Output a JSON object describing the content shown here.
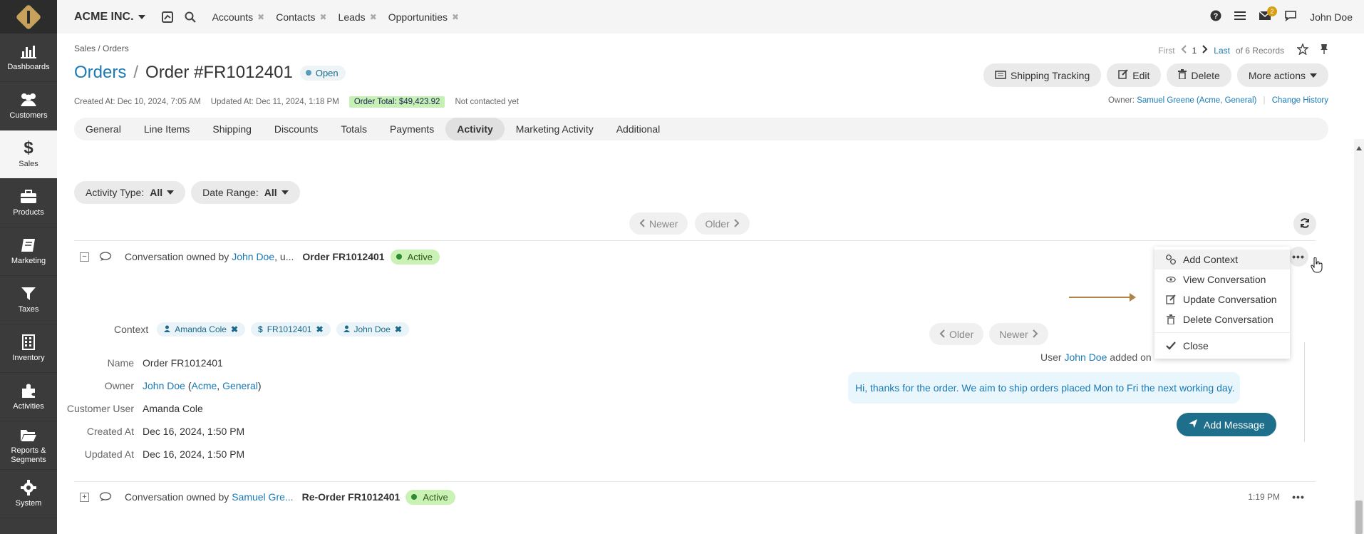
{
  "sidebar": {
    "items": [
      {
        "label": "Dashboards",
        "icon": "dashboards-icon"
      },
      {
        "label": "Customers",
        "icon": "customers-icon"
      },
      {
        "label": "Sales",
        "icon": "dollar-icon"
      },
      {
        "label": "Products",
        "icon": "products-icon"
      },
      {
        "label": "Marketing",
        "icon": "marketing-icon"
      },
      {
        "label": "Taxes",
        "icon": "filter-icon"
      },
      {
        "label": "Inventory",
        "icon": "inventory-icon"
      },
      {
        "label": "Activities",
        "icon": "activities-icon"
      },
      {
        "label": "Reports & Segments",
        "icon": "folder-icon"
      },
      {
        "label": "System",
        "icon": "gear-icon"
      }
    ],
    "active_index": 2
  },
  "topbar": {
    "org": "ACME INC.",
    "tabs": [
      "Accounts",
      "Contacts",
      "Leads",
      "Opportunities"
    ],
    "notification_count": "2",
    "user": "John Doe"
  },
  "breadcrumb": "Sales / Orders",
  "pager": {
    "first": "First",
    "current": "1",
    "last": "Last",
    "of": "of 6 Records"
  },
  "title": {
    "section": "Orders",
    "sep": "/",
    "record": "Order #FR1012401",
    "status": "Open"
  },
  "actions": {
    "shipping": "Shipping Tracking",
    "edit": "Edit",
    "delete": "Delete",
    "more": "More actions"
  },
  "meta": {
    "created": "Created At: Dec 10, 2024, 7:05 AM",
    "updated": "Updated At: Dec 11, 2024, 1:18 PM",
    "total": "Order Total: $49,423.92",
    "contacted": "Not contacted yet"
  },
  "owner": {
    "label": "Owner:",
    "name": "Samuel Greene",
    "org": "(Acme, General)",
    "change": "Change History"
  },
  "tabs": [
    "General",
    "Line Items",
    "Shipping",
    "Discounts",
    "Totals",
    "Payments",
    "Activity",
    "Marketing Activity",
    "Additional"
  ],
  "active_tab": "Activity",
  "filters": {
    "activity_type_label": "Activity Type:",
    "activity_type_value": "All",
    "date_range_label": "Date Range:",
    "date_range_value": "All"
  },
  "list_pager": {
    "newer": "Newer",
    "older": "Older"
  },
  "conversation1": {
    "prefix": "Conversation owned by",
    "owner": "John Doe",
    "rest": ", u...",
    "subject": "Order FR1012401",
    "status": "Active"
  },
  "context": {
    "label": "Context",
    "tags": [
      "Amanda Cole",
      "FR1012401",
      "John Doe"
    ]
  },
  "details": {
    "name_label": "Name",
    "name": "Order FR1012401",
    "owner_label": "Owner",
    "owner_name": "John Doe",
    "owner_org_open": "(",
    "owner_org1": "Acme",
    "owner_comma": ", ",
    "owner_org2": "General",
    "owner_org_close": ")",
    "customer_label": "Customer User",
    "customer": "Amanda Cole",
    "created_label": "Created At",
    "created": "Dec 16, 2024, 1:50 PM",
    "updated_label": "Updated At",
    "updated": "Dec 16, 2024, 1:50 PM"
  },
  "messages": {
    "older": "Older",
    "newer": "Newer",
    "user_prefix": "User",
    "user": "John Doe",
    "user_suffix": "added on",
    "text": "Hi, thanks for the order. We aim to ship orders placed Mon to Fri the next working day.",
    "add": "Add Message"
  },
  "menu": {
    "items": [
      "Add Context",
      "View Conversation",
      "Update Conversation",
      "Delete Conversation",
      "Close"
    ]
  },
  "conversation2": {
    "prefix": "Conversation owned by",
    "owner": "Samuel Gre...",
    "subject": "Re-Order FR1012401",
    "status": "Active",
    "time": "1:19 PM"
  },
  "colors": {
    "accent": "#1a7ab6",
    "sidebar": "#3b3b3b",
    "active_green": "#c9f2b4",
    "arrow": "#b08446"
  }
}
